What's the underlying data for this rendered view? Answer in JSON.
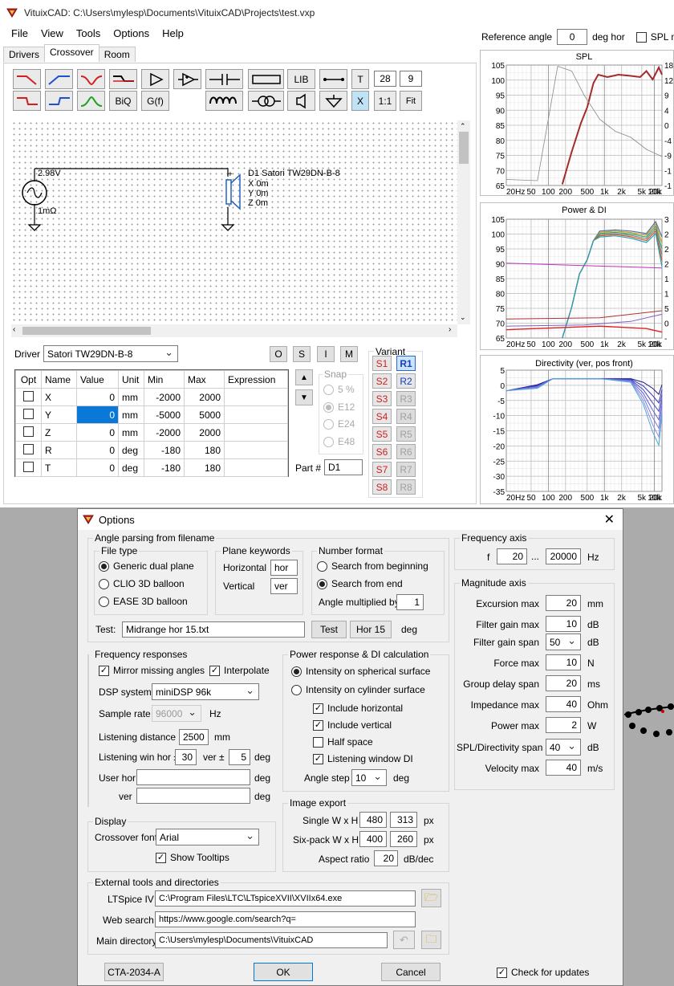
{
  "app": {
    "title": "VituixCAD: C:\\Users\\mylesp\\Documents\\VituixCAD\\Projects\\test.vxp"
  },
  "menu": [
    "File",
    "View",
    "Tools",
    "Options",
    "Help"
  ],
  "ref": {
    "label": "Reference angle",
    "value": "0",
    "unit": "deg hor",
    "spl_label": "SPL ma"
  },
  "tabs": [
    "Drivers",
    "Crossover",
    "Room"
  ],
  "toolbar": {
    "lib": "LIB",
    "biq": "BiQ",
    "gf": "G(f)",
    "t": "T",
    "v28": "28",
    "v9": "9",
    "x": "X",
    "ratio": "1:1",
    "fit": "Fit"
  },
  "schematic": {
    "voltage": "2.98V",
    "res": "1mΩ",
    "driver_name": "D1 Satori TW29DN-B-8",
    "x": "X 0m",
    "y": "Y 0m",
    "z": "Z 0m",
    "plus": "+",
    "minus": "-"
  },
  "driver": {
    "label": "Driver",
    "selected": "Satori TW29DN-B-8",
    "btns": [
      "O",
      "S",
      "I",
      "M"
    ]
  },
  "table": {
    "headers": [
      "Opt",
      "Name",
      "Value",
      "Unit",
      "Min",
      "Max",
      "Expression"
    ],
    "rows": [
      [
        "X",
        "0",
        "mm",
        "-2000",
        "2000"
      ],
      [
        "Y",
        "0",
        "mm",
        "-5000",
        "5000"
      ],
      [
        "Z",
        "0",
        "mm",
        "-2000",
        "2000"
      ],
      [
        "R",
        "0",
        "deg",
        "-180",
        "180"
      ],
      [
        "T",
        "0",
        "deg",
        "-180",
        "180"
      ]
    ]
  },
  "snap": {
    "label": "Snap",
    "opts": [
      "5 %",
      "E12",
      "E24",
      "E48"
    ]
  },
  "part": {
    "label": "Part #",
    "value": "D1"
  },
  "variant": {
    "label": "Variant",
    "s": [
      "S1",
      "S2",
      "S3",
      "S4",
      "S5",
      "S6",
      "S7",
      "S8"
    ],
    "r": [
      "R1",
      "R2",
      "R3",
      "R4",
      "R5",
      "R6",
      "R7",
      "R8"
    ]
  },
  "charts": {
    "spl": {
      "title": "SPL",
      "y": [
        "105",
        "100",
        "95",
        "90",
        "85",
        "80",
        "75",
        "70",
        "65"
      ],
      "right": [
        "18",
        "12",
        "9",
        "4",
        "0",
        "-4",
        "-9",
        "-1",
        "-1"
      ]
    },
    "pdi": {
      "title": "Power & DI",
      "y": [
        "105",
        "100",
        "95",
        "90",
        "85",
        "80",
        "75",
        "70",
        "65"
      ],
      "right": [
        "3",
        "2",
        "2",
        "2",
        "1",
        "1",
        "5",
        "0",
        "-"
      ]
    },
    "dir": {
      "title": "Directivity (ver, pos front)",
      "y": [
        "5",
        "0",
        "-5",
        "-10",
        "-15",
        "-20",
        "-25",
        "-30",
        "-35"
      ]
    },
    "x": [
      "20Hz",
      "50",
      "100",
      "200",
      "500",
      "1k",
      "2k",
      "5k",
      "10k",
      "20k"
    ]
  },
  "dialog": {
    "title": "Options",
    "angle": {
      "label": "Angle parsing from filename",
      "filetype": "File type",
      "ft": [
        "Generic dual plane",
        "CLIO 3D balloon",
        "EASE 3D balloon"
      ],
      "plane": "Plane keywords",
      "horizontal": "Horizontal",
      "hor": "hor",
      "vertical": "Vertical",
      "ver": "ver",
      "number": "Number format",
      "nf": [
        "Search from beginning",
        "Search from end"
      ],
      "mult_label": "Angle multiplied by",
      "mult": "1",
      "test_label": "Test:",
      "test_value": "Midrange hor 15.txt",
      "test_btn": "Test",
      "test_result": "Hor 15",
      "deg": "deg"
    },
    "freq_resp": {
      "label": "Frequency responses",
      "mirror": "Mirror missing angles",
      "interp": "Interpolate",
      "dsp_label": "DSP system",
      "dsp": "miniDSP 96k",
      "sr_label": "Sample rate",
      "sr": "96000",
      "hz": "Hz",
      "ld_label": "Listening distance",
      "ld": "2500",
      "mm": "mm",
      "lw_label": "Listening win hor ±",
      "lw_hor": "30",
      "lw_ver_label": "ver ±",
      "lw_ver": "5",
      "deg": "deg",
      "uh": "User hor",
      "uv": "ver"
    },
    "power": {
      "label": "Power response & DI calculation",
      "opts": [
        "Intensity on spherical surface",
        "Intensity on cylinder surface"
      ],
      "checks": [
        "Include horizontal",
        "Include vertical",
        "Half space",
        "Listening window DI"
      ],
      "step_label": "Angle step",
      "step": "10",
      "deg": "deg"
    },
    "display": {
      "label": "Display",
      "font_label": "Crossover font",
      "font": "Arial",
      "tooltips": "Show Tooltips"
    },
    "image": {
      "label": "Image export",
      "single": "Single W x H",
      "sw": "480",
      "sh": "313",
      "six": "Six-pack W x H",
      "pw": "400",
      "ph": "260",
      "px": "px",
      "aspect_label": "Aspect ratio",
      "aspect": "20",
      "aspect_unit": "dB/dec"
    },
    "freq_axis": {
      "label": "Frequency axis",
      "f": "f",
      "from": "20",
      "dots": "...",
      "to": "20000",
      "hz": "Hz"
    },
    "mag": {
      "label": "Magnitude axis",
      "rows": [
        {
          "label": "Excursion max",
          "value": "20",
          "unit": "mm"
        },
        {
          "label": "Filter gain max",
          "value": "10",
          "unit": "dB"
        },
        {
          "label": "Filter gain span",
          "value": "50",
          "unit": "dB"
        },
        {
          "label": "Force max",
          "value": "10",
          "unit": "N"
        },
        {
          "label": "Group delay span",
          "value": "20",
          "unit": "ms"
        },
        {
          "label": "Impedance max",
          "value": "40",
          "unit": "Ohm"
        },
        {
          "label": "Power max",
          "value": "2",
          "unit": "W"
        },
        {
          "label": "SPL/Directivity span",
          "value": "40",
          "unit": "dB"
        },
        {
          "label": "Velocity max",
          "value": "40",
          "unit": "m/s"
        }
      ]
    },
    "ext": {
      "label": "External tools and directories",
      "lt_label": "LTSpice IV",
      "lt": "C:\\Program Files\\LTC\\LTspiceXVII\\XVIIx64.exe",
      "web_label": "Web search",
      "web": "https://www.google.com/search?q=",
      "main_label": "Main directory",
      "main": "C:\\Users\\mylesp\\Documents\\VituixCAD"
    },
    "buttons": {
      "cta": "CTA-2034-A",
      "ok": "OK",
      "cancel": "Cancel",
      "updates": "Check for updates"
    }
  }
}
